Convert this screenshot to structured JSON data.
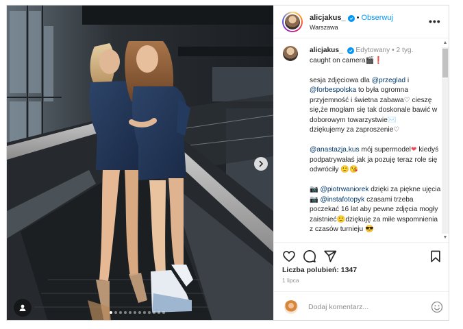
{
  "post": {
    "header": {
      "username": "alicjakus_",
      "separator": "•",
      "follow_label": "Obserwuj",
      "location": "Warszawa",
      "more_icon": "more-horizontal-icon"
    },
    "caption": {
      "username": "alicjakus_",
      "edited_label": "Edytowany",
      "separator": "•",
      "age": "2 tyg.",
      "line1": "caught on camera",
      "para1": {
        "pre": "sesja zdjęciowa dla ",
        "mention1": "@przeglad",
        "mid1": " i ",
        "mention2": "@forbespolska",
        "text": " to była ogromna przyjemność i świetna zabawa♡ cieszę się,że mogłam się tak doskonale bawić w doborowym towarzystwie",
        "tail": "dziękujemy za zaproszenie♡"
      },
      "para2": {
        "mention": "@anastazja.kus",
        "text1": " mój supermodel",
        "heart": "❤",
        "text2": " kiedyś podpatrywałaś jak ja pozuję teraz role się odwróciły 🙂😘"
      },
      "para3": {
        "icon1": "📷",
        "mention1": "@piotrwaniorek",
        "text1": " dzięki za piękne ujęcia",
        "icon2": "📷",
        "mention2": "@instafotopyk",
        "text2": " czasami trzeba poczekać 16 lat aby pewne zdjęcia mogły zaistnieć🙂dziękuję za miłe wspomnienia z czasów turnieju"
      }
    },
    "likes_label": "Liczba polubień: 1347",
    "date": "1 lipca",
    "comment_placeholder": "Dodaj komentarz...",
    "carousel": {
      "slides": 12,
      "active": 0
    }
  },
  "icons": {
    "verified": "verified-badge-icon",
    "like": "heart-icon",
    "comment": "comment-icon",
    "share": "share-icon",
    "save": "bookmark-icon",
    "emoji": "emoji-icon",
    "next": "chevron-right-icon",
    "tags": "user-tag-icon"
  },
  "colors": {
    "accent": "#0095f6",
    "text": "#262626",
    "muted": "#8e8e8e",
    "mention": "#00376b",
    "heart": "#ed4956"
  }
}
